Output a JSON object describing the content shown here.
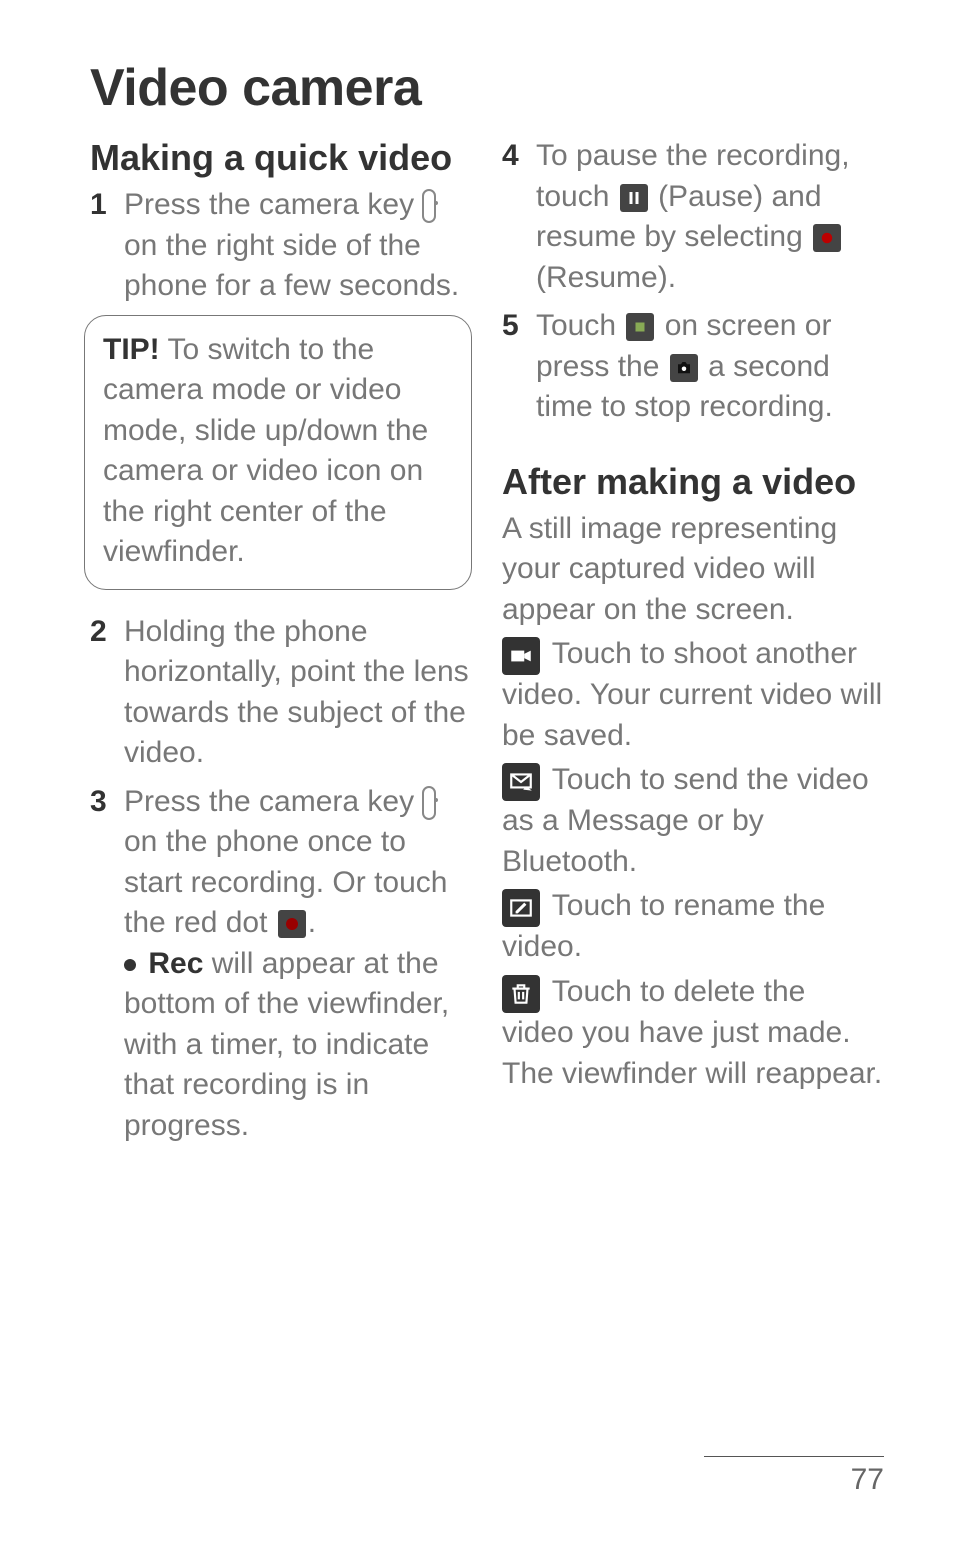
{
  "title": "Video camera",
  "left": {
    "h2": "Making a quick video",
    "step1_num": "1",
    "step1": "Press the camera key on the right side of the phone for a few seconds.",
    "tip_label": "TIP!",
    "tip_body": " To switch to the camera mode or video mode, slide up/down the camera or video icon on the right center of the viewfinder.",
    "step2_num": "2",
    "step2": "Holding the phone horizontally, point the lens towards the subject of the video.",
    "step3_num": "3",
    "step3a": "Press the camera key ",
    "step3b": " on the phone once to start recording. Or touch the red dot ",
    "step3c": ".",
    "rec_label": "Rec",
    "step3d": " will appear at the bottom of the viewfinder, with a timer, to indicate that recording is in progress."
  },
  "right": {
    "step4_num": "4",
    "step4a": "To pause the recording, touch ",
    "step4b": " (Pause) and resume by selecting ",
    "step4c": " (Resume).",
    "step5_num": "5",
    "step5a": "Touch ",
    "step5b": " on screen or press the ",
    "step5c": " a second time to stop recording.",
    "h2b": "After making a video",
    "intro": "A still image representing your captured video will appear on the screen.",
    "item1": " Touch to shoot another video. Your current video will be saved.",
    "item2": " Touch to send the video as a Message or by Bluetooth.",
    "item3": " Touch to rename the video.",
    "item4": " Touch to delete the video you have just made. The viewfinder will reappear."
  },
  "page_number": "77"
}
